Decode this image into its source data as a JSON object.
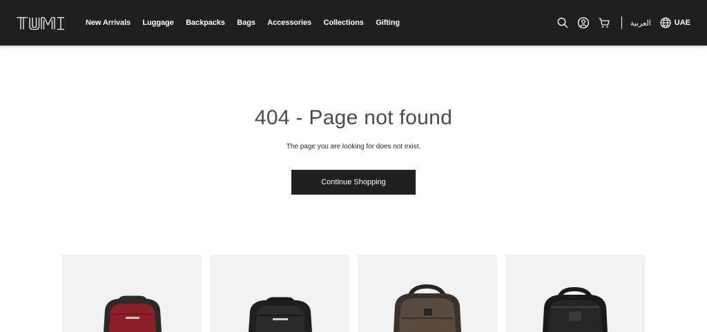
{
  "header": {
    "logo_text": "TUMI",
    "nav": [
      {
        "label": "New Arrivals"
      },
      {
        "label": "Luggage"
      },
      {
        "label": "Backpacks"
      },
      {
        "label": "Bags"
      },
      {
        "label": "Accessories"
      },
      {
        "label": "Collections"
      },
      {
        "label": "Gifting"
      }
    ],
    "icons": [
      "search-icon",
      "account-icon",
      "cart-icon",
      "globe-icon"
    ],
    "language_label": "العربية",
    "region_label": "UAE"
  },
  "main": {
    "title": "404 - Page not found",
    "subtitle": "The page you are looking for does not exist.",
    "cta_label": "Continue Shopping"
  },
  "products": [
    {
      "kind": "backpack",
      "color": "#8c1f28"
    },
    {
      "kind": "backpack",
      "color": "#2b2b2b"
    },
    {
      "kind": "backpack",
      "color": "#5a4a40"
    },
    {
      "kind": "backpack",
      "color": "#262626"
    }
  ],
  "colors": {
    "header_bg": "#1e1f21",
    "header_text": "#ffffff",
    "cta_bg": "#1e1f21",
    "card_bg": "#f2f2f2",
    "title_text": "#4a4a4c"
  }
}
